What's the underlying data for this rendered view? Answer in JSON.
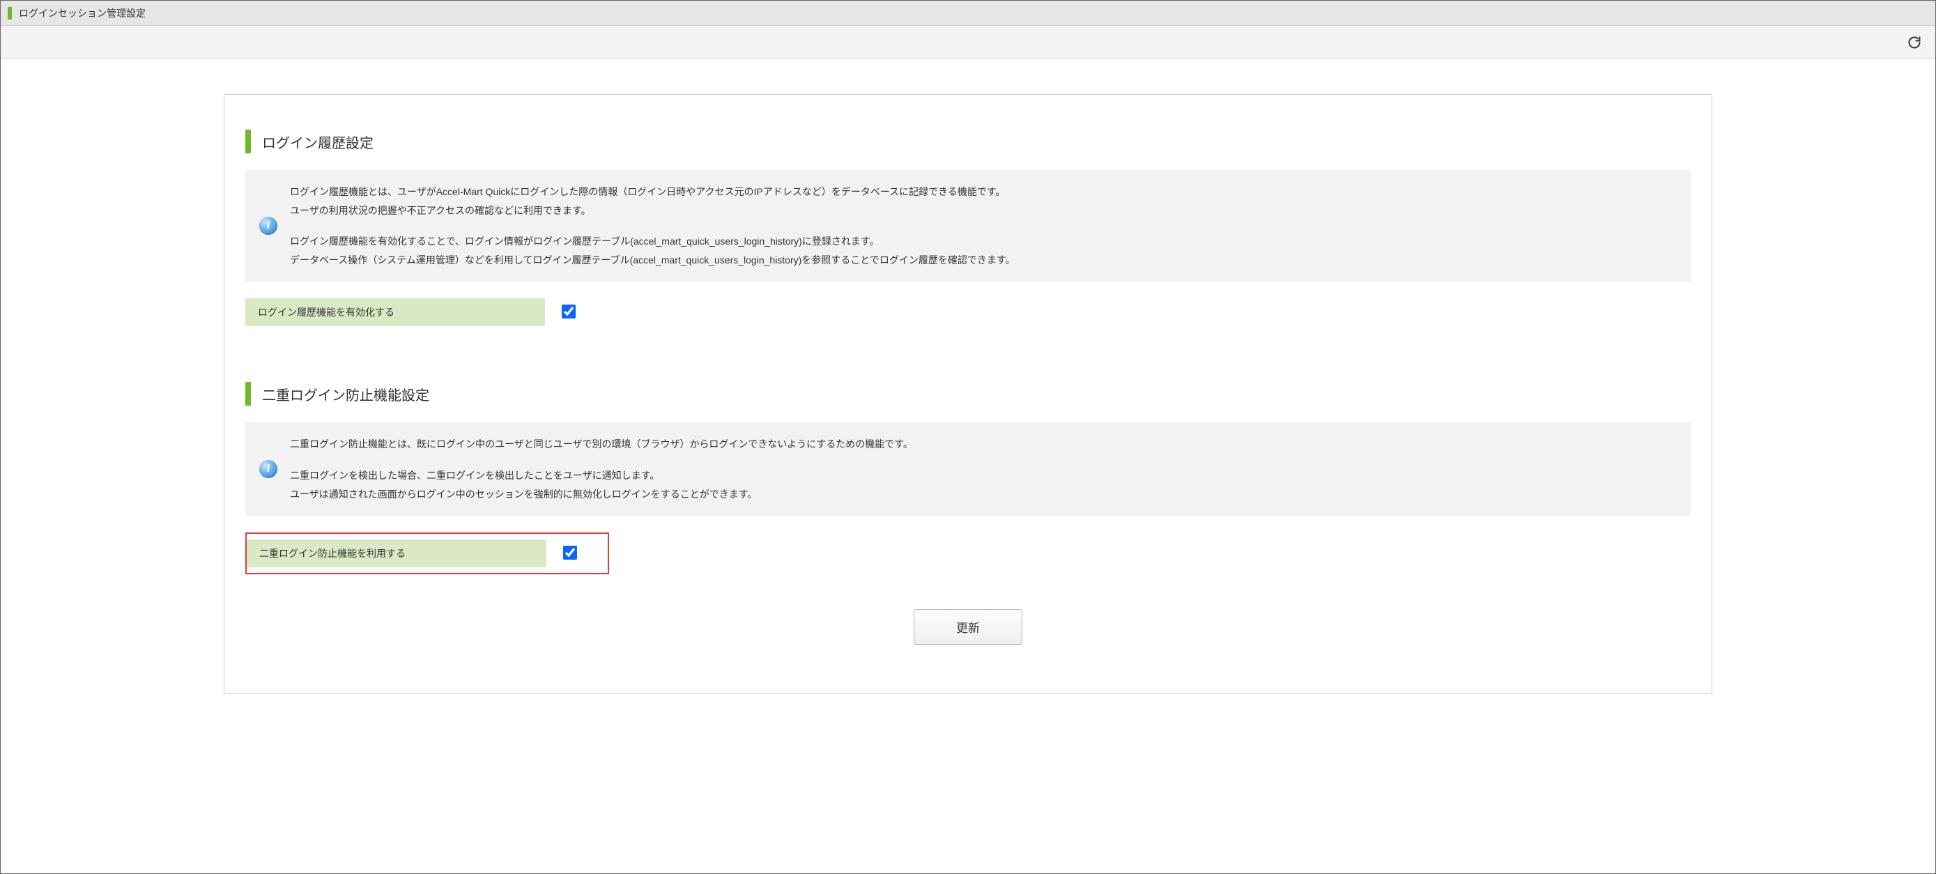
{
  "header": {
    "title": "ログインセッション管理設定"
  },
  "section1": {
    "title": "ログイン履歴設定",
    "info_p1": "ログイン履歴機能とは、ユーザがAccel-Mart Quickにログインした際の情報（ログイン日時やアクセス元のIPアドレスなど）をデータベースに記録できる機能です。",
    "info_p2": "ユーザの利用状況の把握や不正アクセスの確認などに利用できます。",
    "info_p3": "ログイン履歴機能を有効化することで、ログイン情報がログイン履歴テーブル(accel_mart_quick_users_login_history)に登録されます。",
    "info_p4": "データベース操作（システム運用管理）などを利用してログイン履歴テーブル(accel_mart_quick_users_login_history)を参照することでログイン履歴を確認できます。",
    "field_label": "ログイン履歴機能を有効化する",
    "field_checked": true
  },
  "section2": {
    "title": "二重ログイン防止機能設定",
    "info_p1": "二重ログイン防止機能とは、既にログイン中のユーザと同じユーザで別の環境（ブラウザ）からログインできないようにするための機能です。",
    "info_p2": "二重ログインを検出した場合、二重ログインを検出したことをユーザに通知します。",
    "info_p3": "ユーザは通知された画面からログイン中のセッションを強制的に無効化しログインをすることができます。",
    "field_label": "二重ログイン防止機能を利用する",
    "field_checked": true
  },
  "actions": {
    "update_label": "更新"
  }
}
